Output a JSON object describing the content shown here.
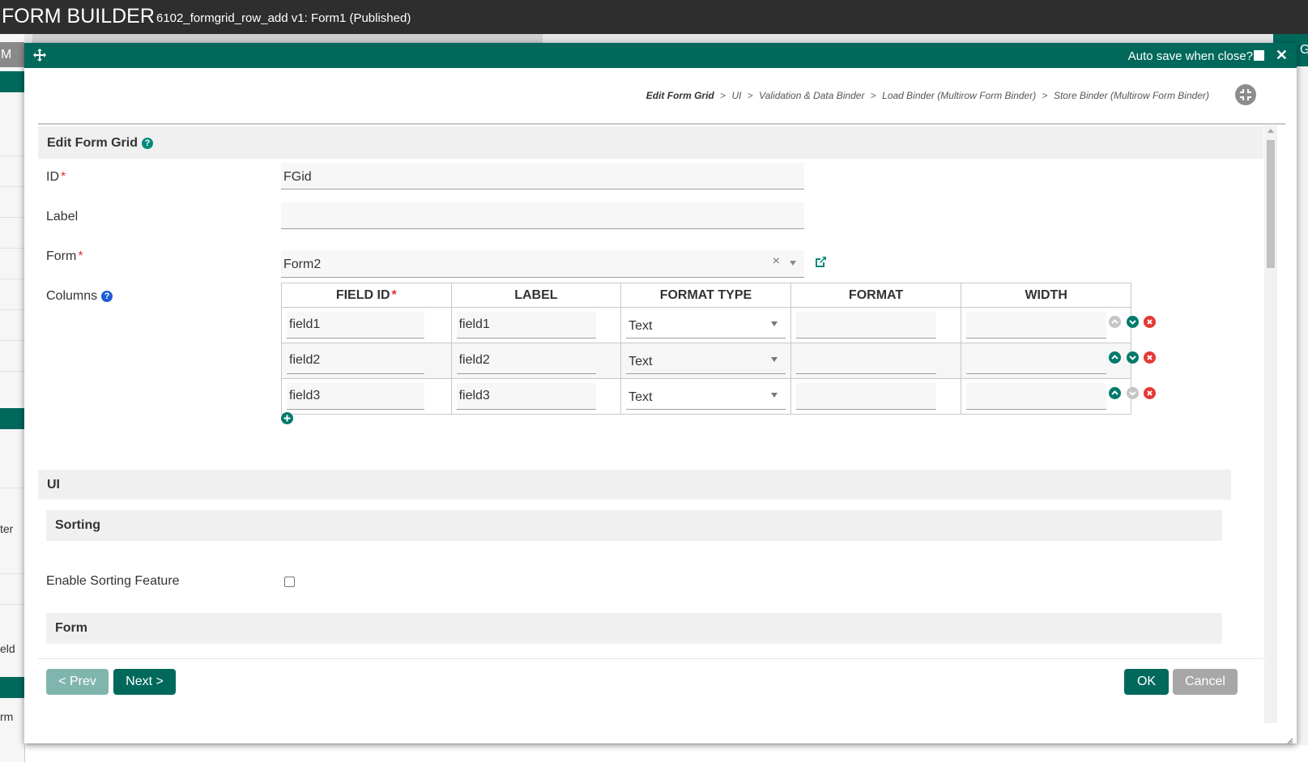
{
  "app": {
    "title": "FORM BUILDER",
    "subtitle": "6102_formgrid_row_add v1: Form1 (Published)"
  },
  "background": {
    "left_tab": "M",
    "right_letter": "G",
    "fragments": [
      "ter",
      "eld",
      "rm"
    ]
  },
  "dialog": {
    "autosave_label": "Auto save when close?",
    "autosave_checked": false,
    "close_symbol": "✕",
    "breadcrumb": {
      "active": "Edit Form Grid",
      "separator": ">",
      "items": [
        "UI",
        "Validation & Data Binder",
        "Load Binder (Multirow Form Binder)",
        "Store Binder (Multirow Form Binder)"
      ]
    }
  },
  "sections": {
    "edit_form_grid": "Edit Form Grid",
    "ui": "UI",
    "sorting": "Sorting",
    "form": "Form"
  },
  "fields": {
    "id_label": "ID",
    "id_value": "FGid",
    "label_label": "Label",
    "label_value": "",
    "form_label": "Form",
    "form_value": "Form2",
    "columns_label": "Columns",
    "required_mark": "*",
    "enable_sorting_label": "Enable Sorting Feature",
    "enable_sorting_checked": false
  },
  "columns_grid": {
    "headers": [
      "FIELD ID",
      "LABEL",
      "FORMAT TYPE",
      "FORMAT",
      "WIDTH"
    ],
    "rows": [
      {
        "field_id": "field1",
        "label": "field1",
        "format_type": "Text",
        "format": "",
        "width": "",
        "up_enabled": false,
        "down_enabled": true
      },
      {
        "field_id": "field2",
        "label": "field2",
        "format_type": "Text",
        "format": "",
        "width": "",
        "up_enabled": true,
        "down_enabled": true
      },
      {
        "field_id": "field3",
        "label": "field3",
        "format_type": "Text",
        "format": "",
        "width": "",
        "up_enabled": true,
        "down_enabled": false
      }
    ]
  },
  "buttons": {
    "prev": "< Prev",
    "next": "Next >",
    "ok": "OK",
    "cancel": "Cancel"
  },
  "colors": {
    "primary": "#00695c",
    "primary_light": "#80b5ae",
    "header_bg": "#2e2e2e",
    "danger": "#e53935",
    "help_blue": "#1e5bd6",
    "cancel_gray": "#a7a7a7"
  },
  "icons": [
    "move-icon",
    "close-icon",
    "fullscreen-exit-icon",
    "help-icon",
    "external-link-icon",
    "clear-icon",
    "chevron-down-icon",
    "move-up-icon",
    "move-down-icon",
    "delete-icon",
    "add-icon",
    "resize-grip-icon"
  ]
}
